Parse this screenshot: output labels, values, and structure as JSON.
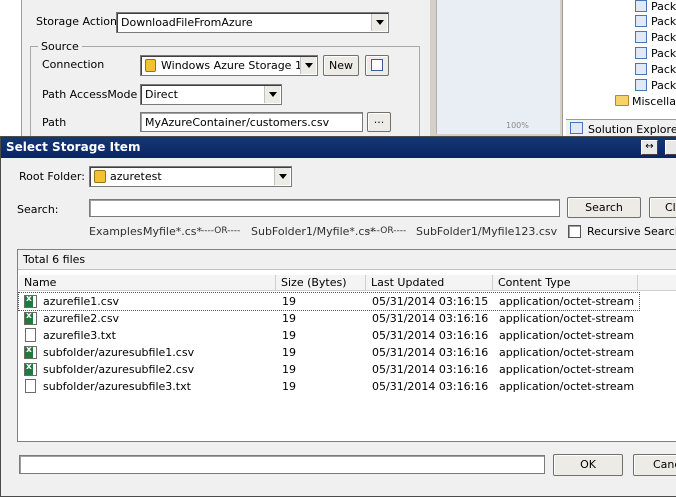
{
  "editor": {
    "storage_action_label": "Storage Action",
    "storage_action_value": "DownloadFileFromAzure",
    "source_legend": "Source",
    "connection_label": "Connection",
    "connection_value": "Windows Azure Storage 1",
    "new_button": "New",
    "path_access_mode_label": "Path AccessMode",
    "path_access_mode_value": "Direct",
    "path_label": "Path",
    "path_value": "MyAzureContainer/customers.csv",
    "browse_button": "..."
  },
  "designer": {
    "zoom": "100%"
  },
  "solution_explorer": {
    "items": [
      "Pack",
      "Pack",
      "Pack",
      "Pack",
      "Pack",
      "Pack"
    ],
    "misc_label": "Miscellan",
    "tab_label": "Solution Explorer"
  },
  "dialog": {
    "title": "Select Storage Item",
    "root_folder_label": "Root Folder:",
    "root_folder_value": "azuretest",
    "search_label": "Search:",
    "search_value": "",
    "search_button": "Search",
    "clear_button": "Cle",
    "examples": {
      "label": "Examples:",
      "ex1": "Myfile*.cs*",
      "or1": "----OR----",
      "ex2": "SubFolder1/Myfile*.cs*",
      "or2": "----OR----",
      "ex3": "SubFolder1/Myfile123.csv"
    },
    "recursive_label": "Recursive Search",
    "recursive_checked": false,
    "total_label": "Total 6 files",
    "columns": [
      "Name",
      "Size (Bytes)",
      "Last Updated",
      "Content Type"
    ],
    "files": [
      {
        "name": "azurefile1.csv",
        "size": "19",
        "updated": "05/31/2014 03:16:15",
        "type": "application/octet-stream",
        "icon": "csv-file-icon"
      },
      {
        "name": "azurefile2.csv",
        "size": "19",
        "updated": "05/31/2014 03:16:16",
        "type": "application/octet-stream",
        "icon": "csv-file-icon"
      },
      {
        "name": "azurefile3.txt",
        "size": "19",
        "updated": "05/31/2014 03:16:16",
        "type": "application/octet-stream",
        "icon": "text-file-icon"
      },
      {
        "name": "subfolder/azuresubfile1.csv",
        "size": "19",
        "updated": "05/31/2014 03:16:16",
        "type": "application/octet-stream",
        "icon": "csv-file-icon"
      },
      {
        "name": "subfolder/azuresubfile2.csv",
        "size": "19",
        "updated": "05/31/2014 03:16:16",
        "type": "application/octet-stream",
        "icon": "csv-file-icon"
      },
      {
        "name": "subfolder/azuresubfile3.txt",
        "size": "19",
        "updated": "05/31/2014 03:16:16",
        "type": "application/octet-stream",
        "icon": "text-file-icon"
      }
    ],
    "selected_path": "",
    "ok_button": "OK",
    "cancel_button": "Canc"
  },
  "colors": {
    "title_bar": "#0a246a",
    "dialog_bg": "#f0f0f0"
  }
}
